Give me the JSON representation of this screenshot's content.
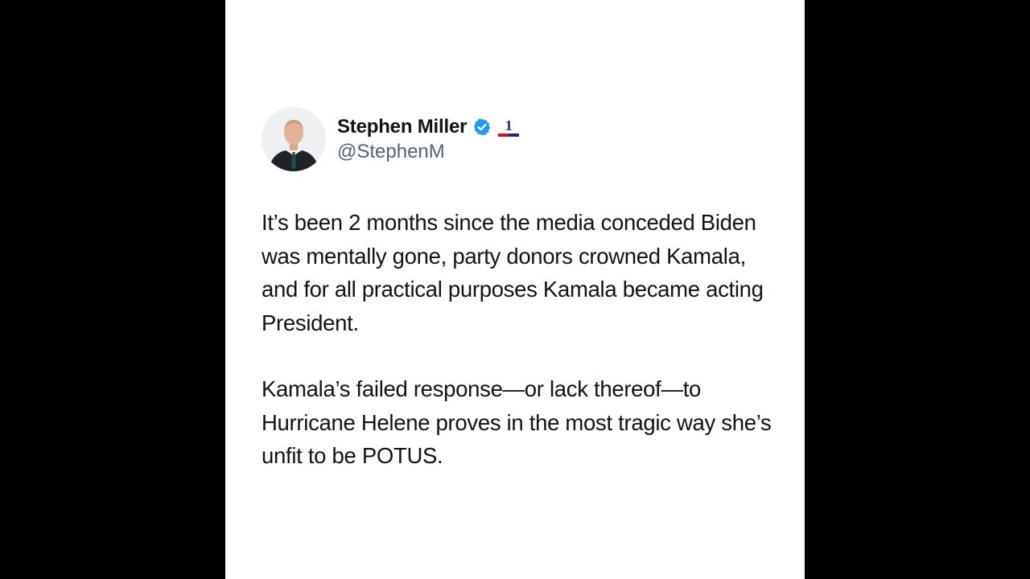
{
  "post": {
    "author_name": "Stephen Miller",
    "handle": "@StephenM",
    "affiliation_badge": "1",
    "paragraphs": [
      "It’s been 2 months since the media conceded Biden was mentally gone, party donors crowned Kamala, and for all practical purposes Kamala became acting President.",
      "Kamala’s failed response—or lack thereof—to Hurricane Helene proves in the most tragic way she’s unfit to be POTUS."
    ]
  },
  "icons": {
    "verified": "verified-badge-icon",
    "affiliation": "affiliation-badge-icon"
  },
  "colors": {
    "verified_blue": "#1d9bf0",
    "text": "#0f1419",
    "secondary_text": "#536471",
    "background": "#ffffff",
    "letterbox": "#000000"
  }
}
